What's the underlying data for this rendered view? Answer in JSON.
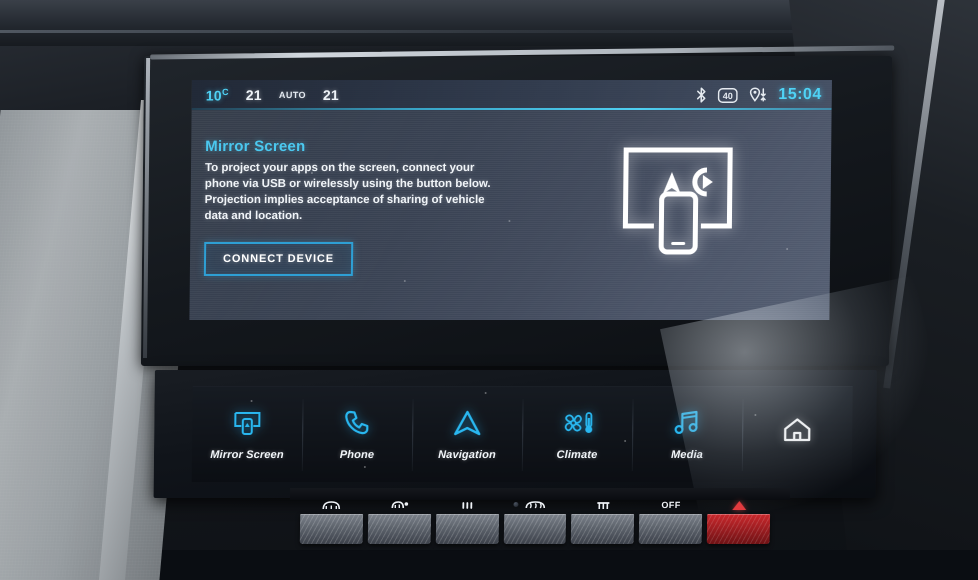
{
  "status_bar": {
    "exterior_temp": "10",
    "exterior_temp_unit": "C",
    "driver_temp": "21",
    "auto_label": "AUTO",
    "passenger_temp": "21",
    "bluetooth_icon": "bluetooth-icon",
    "speed_limit_icon": "speed-limit-40-icon",
    "speed_limit_value": "40",
    "navigation_icon": "location-pin-icon",
    "clock": "15:04"
  },
  "main": {
    "title": "Mirror Screen",
    "description": "To project your apps on the screen, connect your phone via USB or wirelessly using the button below. Projection implies acceptance of sharing of vehicle data and location.",
    "connect_button": "CONNECT DEVICE",
    "illustration": "screen-with-phone-projection-icon"
  },
  "toolbar": {
    "items": [
      {
        "label": "Mirror Screen",
        "icon": "mirror-screen-icon"
      },
      {
        "label": "Phone",
        "icon": "phone-handset-icon"
      },
      {
        "label": "Navigation",
        "icon": "navigation-arrow-icon"
      },
      {
        "label": "Climate",
        "icon": "fan-thermometer-icon"
      },
      {
        "label": "Media",
        "icon": "music-note-icon"
      },
      {
        "label": "",
        "icon": "home-icon"
      }
    ]
  },
  "physical_buttons": [
    {
      "name": "windscreen-demist-button",
      "glyph": "icon"
    },
    {
      "name": "rear-demist-button",
      "glyph": "icon"
    },
    {
      "name": "air-recirculation-button",
      "glyph": "icon"
    },
    {
      "name": "front-defrost-button",
      "glyph": "icon"
    },
    {
      "name": "air-distribution-button",
      "glyph": "icon"
    },
    {
      "name": "climate-off-button",
      "glyph": "text",
      "label": "OFF"
    },
    {
      "name": "hazard-lights-button",
      "glyph": "triangle"
    }
  ],
  "colors": {
    "accent_cyan": "#4fd2f5",
    "title_cyan": "#4bc8ef",
    "button_border": "#2e9fd4",
    "text_white": "#f0f4f8",
    "hazard_red": "#c9282c"
  }
}
